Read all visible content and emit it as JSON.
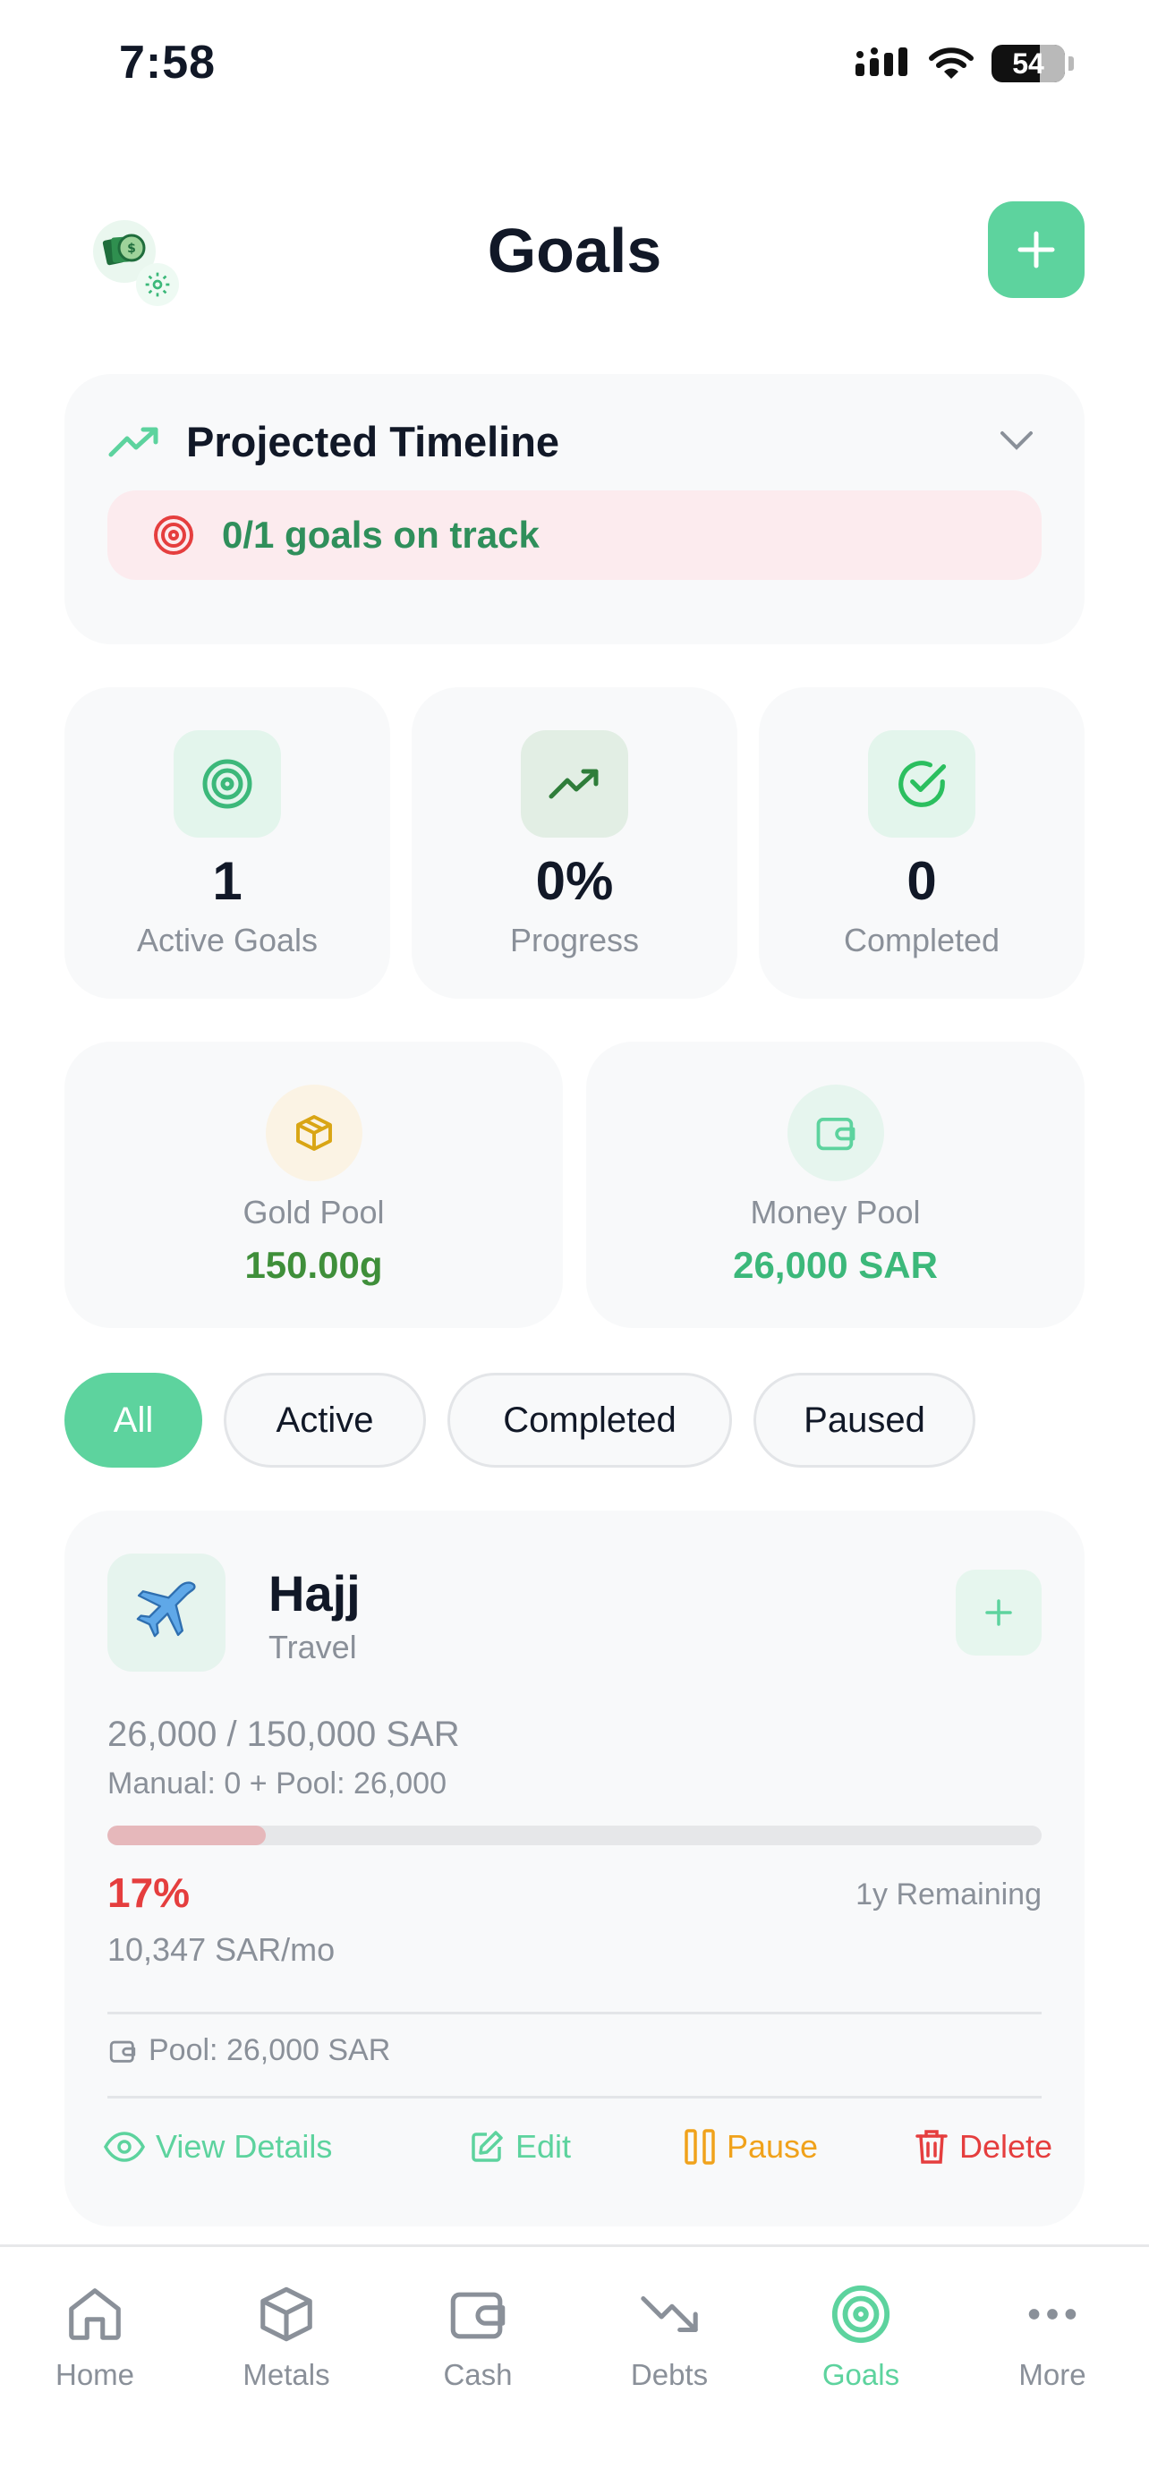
{
  "status_bar": {
    "time": "7:58",
    "battery": "54"
  },
  "header": {
    "title": "Goals"
  },
  "timeline": {
    "title": "Projected Timeline",
    "status": "0/1 goals on track"
  },
  "stats": [
    {
      "value": "1",
      "label": "Active Goals",
      "icon": "target-icon"
    },
    {
      "value": "0%",
      "label": "Progress",
      "icon": "trending-up-icon"
    },
    {
      "value": "0",
      "label": "Completed",
      "icon": "check-circle-icon"
    }
  ],
  "pools": {
    "gold": {
      "label": "Gold Pool",
      "value": "150.00g",
      "color": "#3f8f3a"
    },
    "money": {
      "label": "Money Pool",
      "value": "26,000 SAR",
      "color": "#3cb87a"
    }
  },
  "filters": [
    "All",
    "Active",
    "Completed",
    "Paused"
  ],
  "active_filter": "All",
  "goal": {
    "emoji": "✈️",
    "name": "Hajj",
    "category": "Travel",
    "amount": "26,000 / 150,000 SAR",
    "breakdown": "Manual: 0 + Pool: 26,000",
    "progress": 0.17,
    "percent": "17%",
    "remaining": "1y Remaining",
    "monthly": "10,347 SAR/mo",
    "pool": "Pool: 26,000 SAR",
    "actions": {
      "view": "View Details",
      "edit": "Edit",
      "pause": "Pause",
      "delete": "Delete"
    }
  },
  "tabs": [
    {
      "label": "Home",
      "icon": "home-icon"
    },
    {
      "label": "Metals",
      "icon": "cube-icon"
    },
    {
      "label": "Cash",
      "icon": "wallet-icon"
    },
    {
      "label": "Debts",
      "icon": "trending-down-icon"
    },
    {
      "label": "Goals",
      "icon": "target-icon"
    },
    {
      "label": "More",
      "icon": "more-icon"
    }
  ],
  "active_tab": "Goals",
  "colors": {
    "accent": "#5dd39e",
    "danger": "#e53e3e",
    "warning": "#f0a21b",
    "muted": "#8a9099"
  }
}
